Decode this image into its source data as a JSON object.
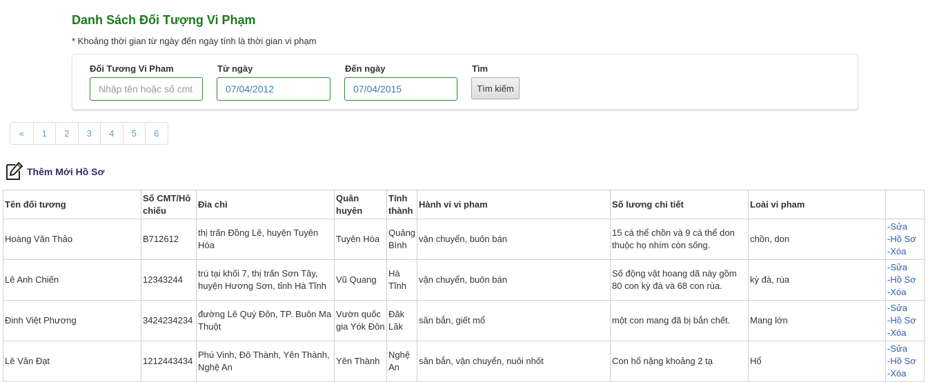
{
  "page": {
    "title": "Danh Sách Đối Tượng Vi Phạm",
    "note": "* Khoảng thời gian từ ngày đến ngày tính là thời gian vi phạm"
  },
  "filters": {
    "subject_label": "Đối Tương Vi Pham",
    "subject_placeholder": "Nhập tên hoặc số cmt",
    "from_label": "Từ ngày",
    "from_value": "07/04/2012",
    "to_label": "Đến ngày",
    "to_value": "07/04/2015",
    "search_label": "Tìm",
    "search_button": "Tìm kiếm"
  },
  "pagination": [
    "«",
    "1",
    "2",
    "3",
    "4",
    "5",
    "6"
  ],
  "add_record": {
    "label": "Thêm Mới Hồ Sơ",
    "icon": "edit-document-icon"
  },
  "table": {
    "headers": [
      "Tên đối tương",
      "Số CMT/Hô chiếu",
      "Đia chỉ",
      "Quân huyên",
      "Tỉnh thành",
      "Hành vi vi pham",
      "Số lương chi tiết",
      "Loài vi pham",
      ""
    ],
    "actions": [
      "-Sửa",
      "-Hồ Sơ",
      "-Xóa"
    ],
    "rows": [
      [
        "Hoàng Văn Thảo",
        "B712612",
        "thị trấn Đồng Lê, huyện Tuyên Hóa",
        "Tuyên Hóa",
        "Quảng Bình",
        "vận chuyển, buôn bán",
        "15 cá thể chồn và 9 cá thể don thuộc họ nhím còn sống.",
        "chồn, don"
      ],
      [
        "Lê Anh Chiến",
        "12343244",
        "trú tại khối 7, thị trấn Sơn Tây, huyện Hương Sơn, tỉnh Hà Tĩnh",
        "Vũ Quang",
        "Hà Tĩnh",
        "vận chuyển, buôn bán",
        "Số động vật hoang dã này gồm 80 con kỳ đà và 68 con rùa.",
        "kỳ đà, rùa"
      ],
      [
        "Đinh Việt Phương",
        "3424234234",
        "đường Lê Quý Đôn, TP. Buôn Ma Thuột",
        "Vườn quốc gia Yók Đôn",
        "Đăk Lăk",
        "săn bắn, giết mổ",
        "một con mang đã bị bắn chết.",
        "Mang lớn"
      ],
      [
        "Lê Văn Đạt",
        "1212443434",
        "Phú Vinh, Đô Thành, Yên Thành, Nghệ An",
        "Yên Thành",
        "Nghệ An",
        "săn bắn, vận chuyển, nuôi nhốt",
        "Con hổ nặng khoảng 2 tạ",
        "Hổ"
      ]
    ]
  },
  "colors": {
    "title": "#1a7a1a",
    "input_border": "#2b8a2b",
    "link": "#2a5db0",
    "pager": "#5aa0c8"
  }
}
